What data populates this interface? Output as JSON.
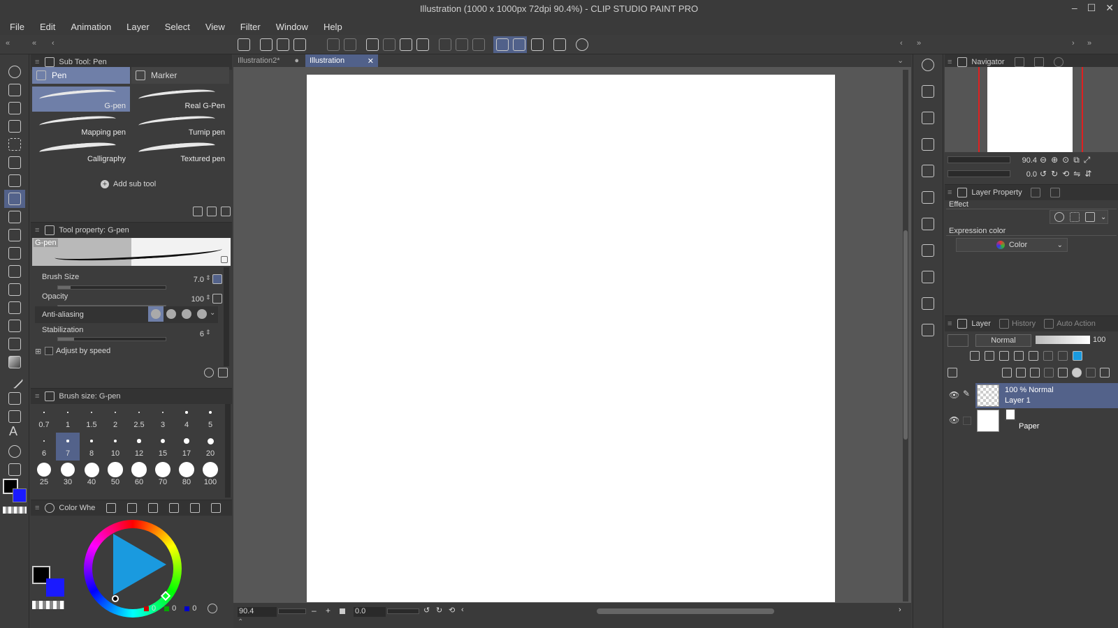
{
  "window": {
    "title": "Illustration (1000 x 1000px 72dpi 90.4%)  - CLIP STUDIO PAINT PRO",
    "controls": [
      "–",
      "☐",
      "✕"
    ]
  },
  "menu": [
    "File",
    "Edit",
    "Animation",
    "Layer",
    "Select",
    "View",
    "Filter",
    "Window",
    "Help"
  ],
  "subtool_panel": {
    "title": "Sub Tool: Pen",
    "groups": [
      "Pen",
      "Marker"
    ],
    "items": [
      "G-pen",
      "Real G-Pen",
      "Mapping pen",
      "Turnip pen",
      "Calligraphy",
      "Textured pen"
    ],
    "add_label": "Add sub tool"
  },
  "tool_property": {
    "title": "Tool property: G-pen",
    "preview_label": "G-pen",
    "brush_size_label": "Brush Size",
    "brush_size_value": "7.0",
    "brush_size_fraction": 0.12,
    "opacity_label": "Opacity",
    "opacity_value": "100",
    "opacity_fraction": 1.0,
    "antialias_label": "Anti-aliasing",
    "stabilization_label": "Stabilization",
    "stabilization_value": "6",
    "stabilization_fraction": 0.15,
    "adjust_label": "Adjust by speed"
  },
  "brush_size_panel": {
    "title": "Brush size: G-pen",
    "sizes": [
      "0.7",
      "1",
      "1.5",
      "2",
      "2.5",
      "3",
      "4",
      "5",
      "6",
      "7",
      "8",
      "10",
      "12",
      "15",
      "17",
      "20",
      "25",
      "30",
      "40",
      "50",
      "60",
      "70",
      "80",
      "100"
    ],
    "selected": "7"
  },
  "color_panel": {
    "title": "Color Whe",
    "rgb": [
      "0",
      "0",
      "0"
    ],
    "main_color": "#000000",
    "sub_color": "#1a1aff"
  },
  "canvas": {
    "tabs": [
      "Illustration2*",
      "Illustration"
    ],
    "active_tab": "Illustration",
    "zoom": "90.4",
    "rotation": "0.0"
  },
  "navigator": {
    "title": "Navigator",
    "zoom": "90.4",
    "rotation": "0.0"
  },
  "layer_property": {
    "title": "Layer Property",
    "effect_label": "Effect",
    "expression_label": "Expression color",
    "expression_value": "Color"
  },
  "layer_panel": {
    "tabs": [
      "Layer",
      "History",
      "Auto Action"
    ],
    "blend_mode": "Normal",
    "opacity": "100",
    "layers": [
      {
        "top": "100 % Normal",
        "name": "Layer 1"
      },
      {
        "name": "Paper"
      }
    ]
  },
  "colors": {
    "accent": "#6f7fa8",
    "selected_row": "#53628a"
  }
}
